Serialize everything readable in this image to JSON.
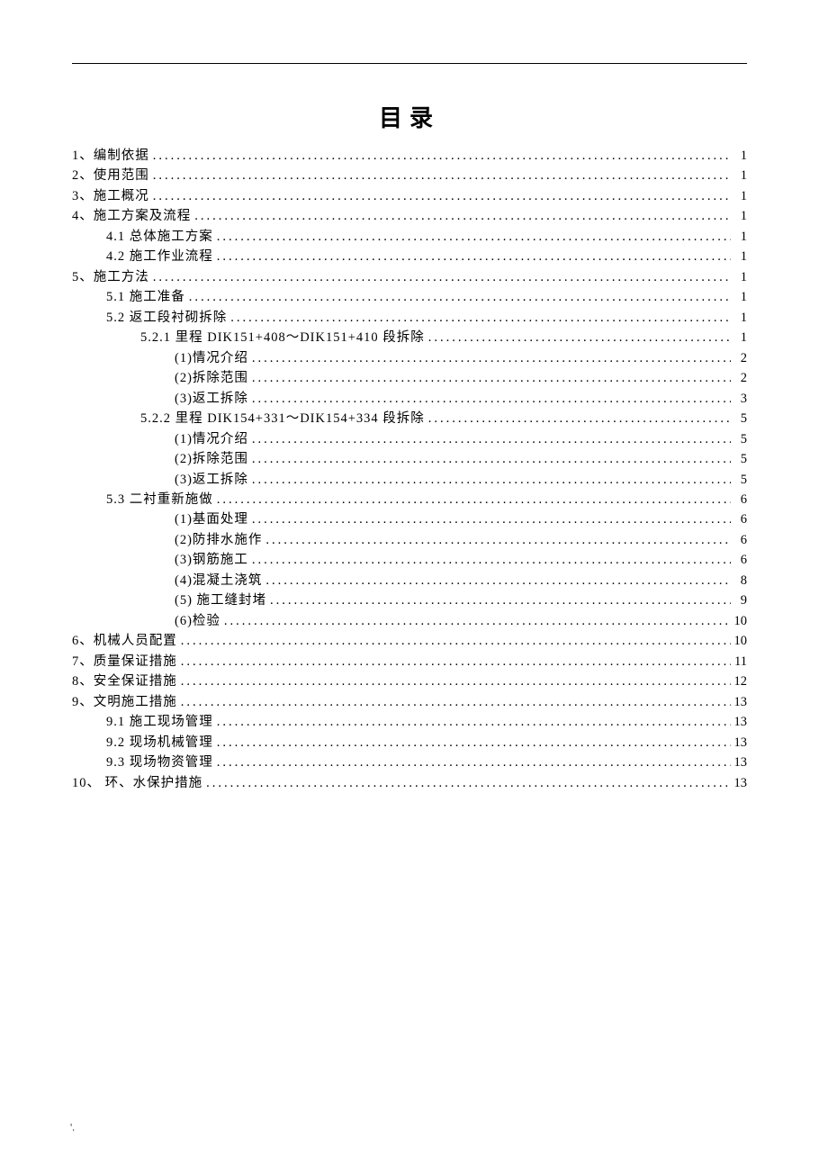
{
  "title": "目录",
  "footer_mark": "'.",
  "toc": [
    {
      "level": 1,
      "label": "1、编制依据",
      "page": "1"
    },
    {
      "level": 1,
      "label": "2、使用范围",
      "page": "1"
    },
    {
      "level": 1,
      "label": "3、施工概况",
      "page": "1"
    },
    {
      "level": 1,
      "label": "4、施工方案及流程",
      "page": "1"
    },
    {
      "level": 2,
      "label": "4.1 总体施工方案",
      "page": "1"
    },
    {
      "level": 2,
      "label": "4.2 施工作业流程",
      "page": "1"
    },
    {
      "level": 1,
      "label": "5、施工方法",
      "page": "1"
    },
    {
      "level": 2,
      "label": "5.1 施工准备",
      "page": "1"
    },
    {
      "level": 2,
      "label": "5.2 返工段衬砌拆除",
      "page": "1"
    },
    {
      "level": 3,
      "label": "5.2.1 里程 DIK151+408～DIK151+410 段拆除 ",
      "page": "1"
    },
    {
      "level": 4,
      "label": "(1)情况介绍 ",
      "page": "2"
    },
    {
      "level": 4,
      "label": "(2)拆除范围 ",
      "page": "2"
    },
    {
      "level": 4,
      "label": "(3)返工拆除 ",
      "page": "3"
    },
    {
      "level": 3,
      "label": "5.2.2 里程 DIK154+331～DIK154+334 段拆除 ",
      "page": "5"
    },
    {
      "level": 4,
      "label": "(1)情况介绍 ",
      "page": "5"
    },
    {
      "level": 4,
      "label": "(2)拆除范围 ",
      "page": "5"
    },
    {
      "level": 4,
      "label": "(3)返工拆除 ",
      "page": "5"
    },
    {
      "level": 2,
      "label": "5.3 二衬重新施做",
      "page": "6"
    },
    {
      "level": 4,
      "label": "(1)基面处理 ",
      "page": "6"
    },
    {
      "level": 4,
      "label": "(2)防排水施作 ",
      "page": "6"
    },
    {
      "level": 4,
      "label": "(3)钢筋施工 ",
      "page": "6"
    },
    {
      "level": 4,
      "label": "(4)混凝土浇筑 ",
      "page": "8"
    },
    {
      "level": 4,
      "label": "(5) 施工缝封堵 ",
      "page": "9"
    },
    {
      "level": 4,
      "label": "(6)检验 ",
      "page": "10"
    },
    {
      "level": 1,
      "label": "6、机械人员配置",
      "page": "10"
    },
    {
      "level": 1,
      "label": "7、质量保证措施",
      "page": "11"
    },
    {
      "level": 1,
      "label": "8、安全保证措施",
      "page": "12"
    },
    {
      "level": 1,
      "label": "9、文明施工措施",
      "page": "13"
    },
    {
      "level": 2,
      "label": "9.1 施工现场管理",
      "page": "13"
    },
    {
      "level": 2,
      "label": "9.2  现场机械管理 ",
      "page": "13"
    },
    {
      "level": 2,
      "label": "9.3  现场物资管理 ",
      "page": "13"
    },
    {
      "level": 1,
      "label": "10、  环、水保护措施",
      "page": "13"
    }
  ]
}
